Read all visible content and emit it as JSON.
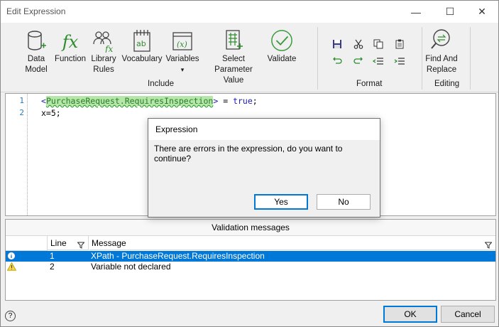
{
  "window": {
    "title": "Edit Expression",
    "minimize": "—",
    "maximize": "☐",
    "close": "✕"
  },
  "ribbon": {
    "include_buttons": [
      {
        "label": "Data\nModel",
        "icon": "database-add-icon"
      },
      {
        "label": "Function",
        "icon": "function-fx-icon"
      },
      {
        "label": "Library\nRules",
        "icon": "library-rules-icon"
      },
      {
        "label": "Vocabulary",
        "icon": "vocabulary-ab-icon"
      },
      {
        "label": "Variables",
        "icon": "variables-x-icon"
      },
      {
        "label": "Select Parameter\nValue",
        "icon": "select-parameter-icon"
      },
      {
        "label": "Validate",
        "icon": "validate-check-icon"
      }
    ],
    "variables_dropdown": "▾",
    "group_include": "Include",
    "group_format": "Format",
    "find_replace": {
      "label": "Find And\nReplace",
      "icon": "find-replace-icon"
    },
    "group_editing": "Editing",
    "format_tools": [
      "save-icon",
      "cut-icon",
      "copy-icon",
      "paste-icon",
      "undo-icon",
      "redo-icon",
      "outdent-icon",
      "indent-icon"
    ]
  },
  "editor": {
    "line_numbers": [
      "1",
      "2"
    ],
    "line1": {
      "open": "<",
      "field": "PurchaseRequest.RequiresInspection",
      "close": ">",
      "op": " = ",
      "value": "true",
      "end": ";"
    },
    "line2": {
      "text": "x=5;"
    }
  },
  "validation": {
    "title": "Validation messages",
    "col_line": "Line",
    "col_message": "Message",
    "rows": [
      {
        "line": "1",
        "message": "XPath - PurchaseRequest.RequiresInspection",
        "icon": "info-icon",
        "selected": true
      },
      {
        "line": "2",
        "message": "Variable not declared",
        "icon": "warning-icon",
        "selected": false
      }
    ]
  },
  "footer": {
    "help": "?",
    "ok": "OK",
    "cancel": "Cancel"
  },
  "dialog": {
    "title": "Expression",
    "message": "There are errors in the expression, do you want to continue?",
    "yes": "Yes",
    "no": "No"
  }
}
